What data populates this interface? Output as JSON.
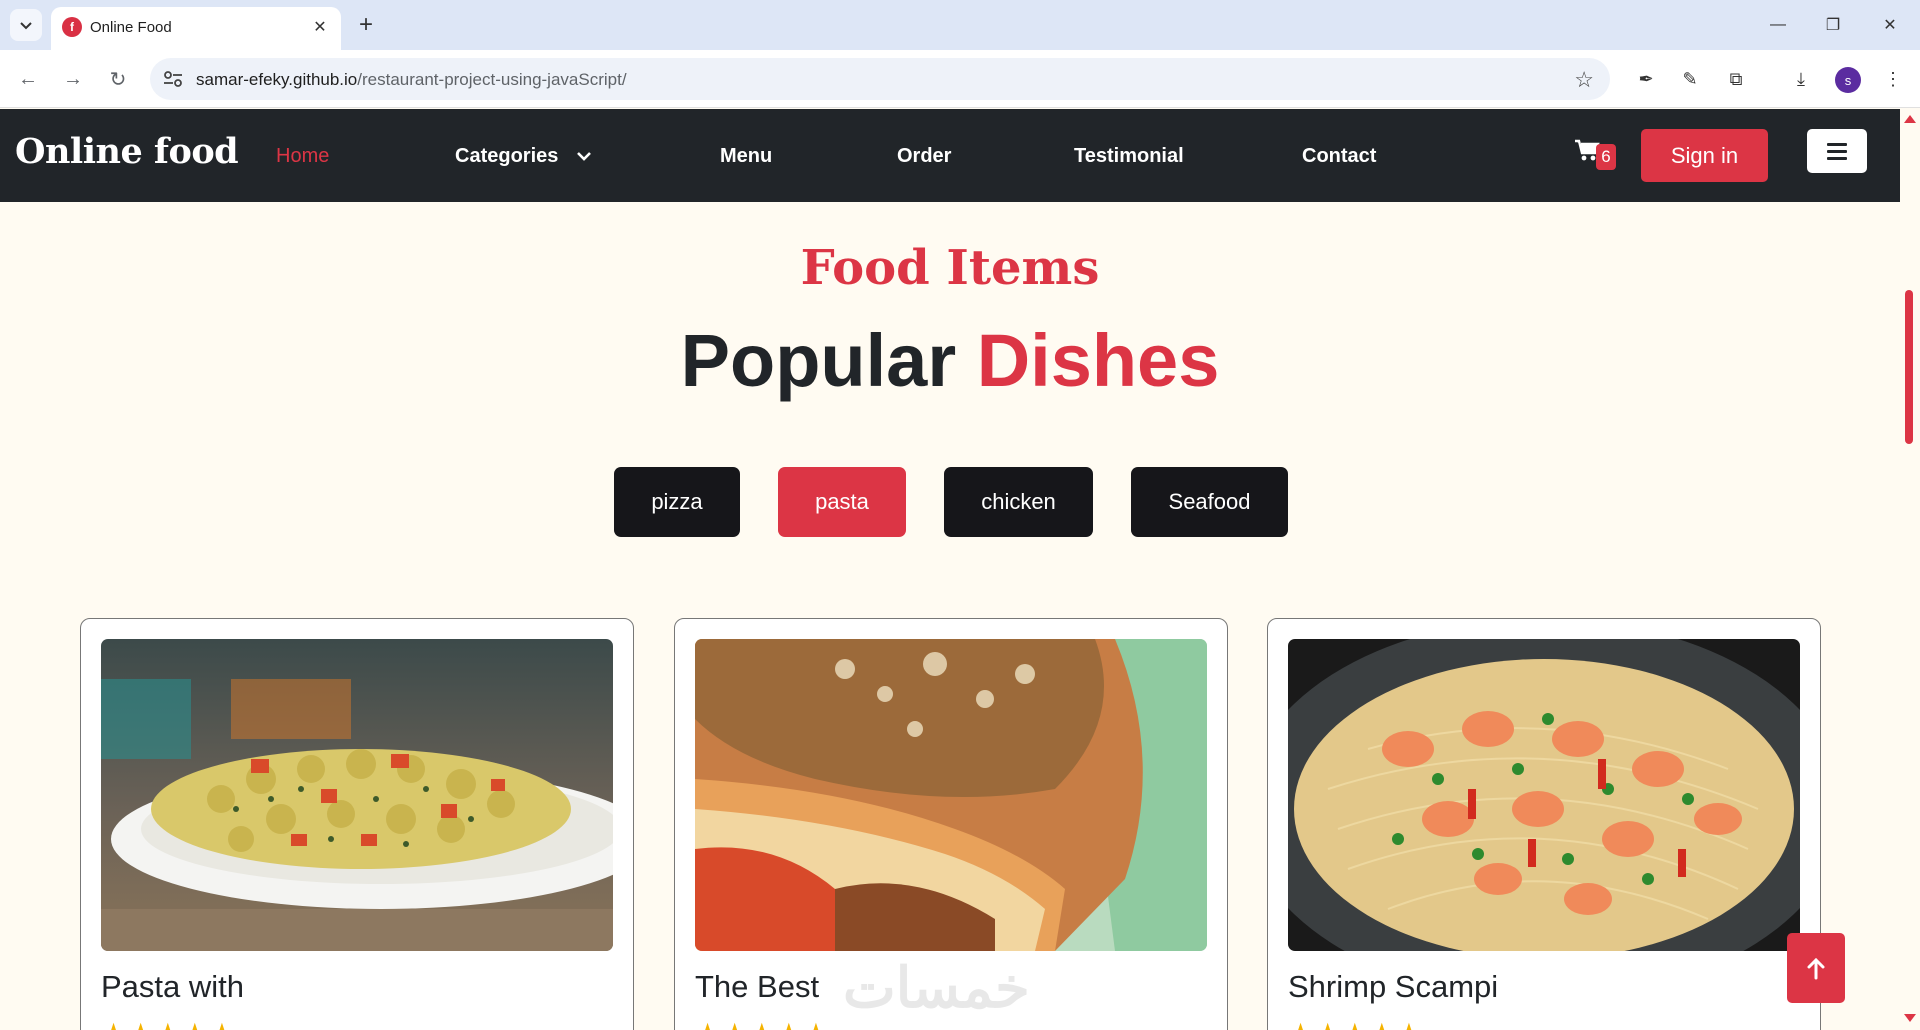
{
  "browser": {
    "tab_title": "Online Food",
    "favicon_letter": "f",
    "url_host": "samar-efeky.github.io",
    "url_path": "/restaurant-project-using-javaScript/",
    "profile_initial": "s"
  },
  "navbar": {
    "brand": "Online food",
    "links": [
      {
        "label": "Home",
        "active": true
      },
      {
        "label": "Categories"
      },
      {
        "label": "Menu"
      },
      {
        "label": "Order"
      },
      {
        "label": "Testimonial"
      },
      {
        "label": "Contact"
      }
    ],
    "cart_count": "6",
    "signin_label": "Sign in",
    "icons": [
      "cart-icon",
      "hamburger-icon",
      "chevron-down-icon"
    ]
  },
  "section": {
    "subtitle": "Food Items",
    "title_part1": "Popular",
    "title_part2": "Dishes"
  },
  "filters": [
    {
      "label": "pizza",
      "active": false
    },
    {
      "label": "pasta",
      "active": true
    },
    {
      "label": "chicken",
      "active": false
    },
    {
      "label": "Seafood",
      "active": false
    }
  ],
  "cards": [
    {
      "title": "Pasta with",
      "stars": "★★★★★"
    },
    {
      "title": "The Best",
      "stars": "★★★★★"
    },
    {
      "title": "Shrimp Scampi",
      "stars": "★★★★★"
    }
  ],
  "watermark": "خمسات",
  "colors": {
    "accent": "#dc3545",
    "navbar_bg": "#212529",
    "page_bg": "#fffbf2",
    "filter_bg": "#16161a",
    "star": "#f5b301"
  }
}
